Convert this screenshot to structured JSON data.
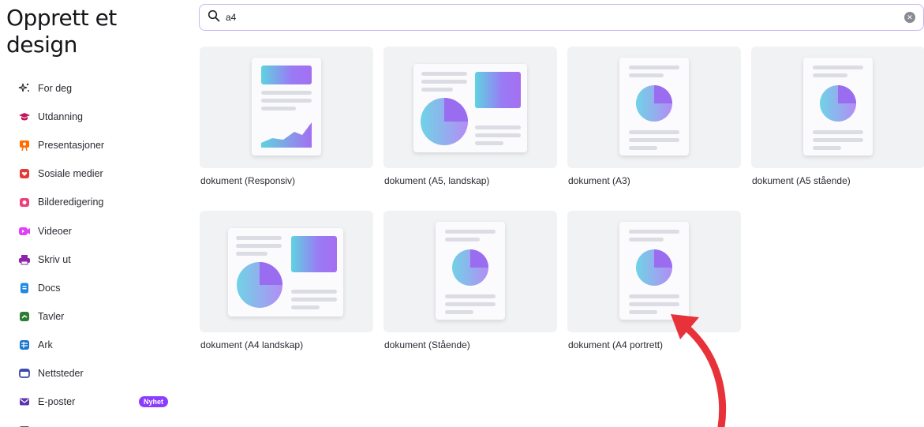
{
  "sidebar": {
    "title": "Opprett et design",
    "items": [
      {
        "label": "For deg",
        "icon": "sparkle-icon",
        "color": "#333333"
      },
      {
        "label": "Utdanning",
        "icon": "graduation-cap-icon",
        "color": "#c2185b"
      },
      {
        "label": "Presentasjoner",
        "icon": "presentation-icon",
        "color": "#ff6d00"
      },
      {
        "label": "Sosiale medier",
        "icon": "heart-icon",
        "color": "#e53935"
      },
      {
        "label": "Bilderedigering",
        "icon": "camera-icon",
        "color": "#ec407a"
      },
      {
        "label": "Videoer",
        "icon": "video-icon",
        "color": "#e040fb"
      },
      {
        "label": "Skriv ut",
        "icon": "printer-icon",
        "color": "#8e24aa"
      },
      {
        "label": "Docs",
        "icon": "docs-icon",
        "color": "#1e88e5"
      },
      {
        "label": "Tavler",
        "icon": "whiteboard-icon",
        "color": "#2e7d32"
      },
      {
        "label": "Ark",
        "icon": "sheet-icon",
        "color": "#1976d2"
      },
      {
        "label": "Nettsteder",
        "icon": "website-icon",
        "color": "#3949ab"
      },
      {
        "label": "E-poster",
        "icon": "email-icon",
        "color": "#5e35b1",
        "badge": "Nyhet"
      }
    ]
  },
  "search": {
    "value": "a4"
  },
  "results": [
    {
      "label": "dokument (Responsiv)",
      "thumb": "responsive"
    },
    {
      "label": "dokument (A5, landskap)",
      "thumb": "landscape"
    },
    {
      "label": "dokument (A3)",
      "thumb": "portrait"
    },
    {
      "label": "dokument (A5 stående)",
      "thumb": "portrait"
    },
    {
      "label": "dokument (A4 landskap)",
      "thumb": "landscape"
    },
    {
      "label": "dokument (Stående)",
      "thumb": "portrait"
    },
    {
      "label": "dokument (A4 portrett)",
      "thumb": "portrait"
    }
  ],
  "annotation": {
    "icon": "red-arrow-icon",
    "color": "#e8323a"
  }
}
